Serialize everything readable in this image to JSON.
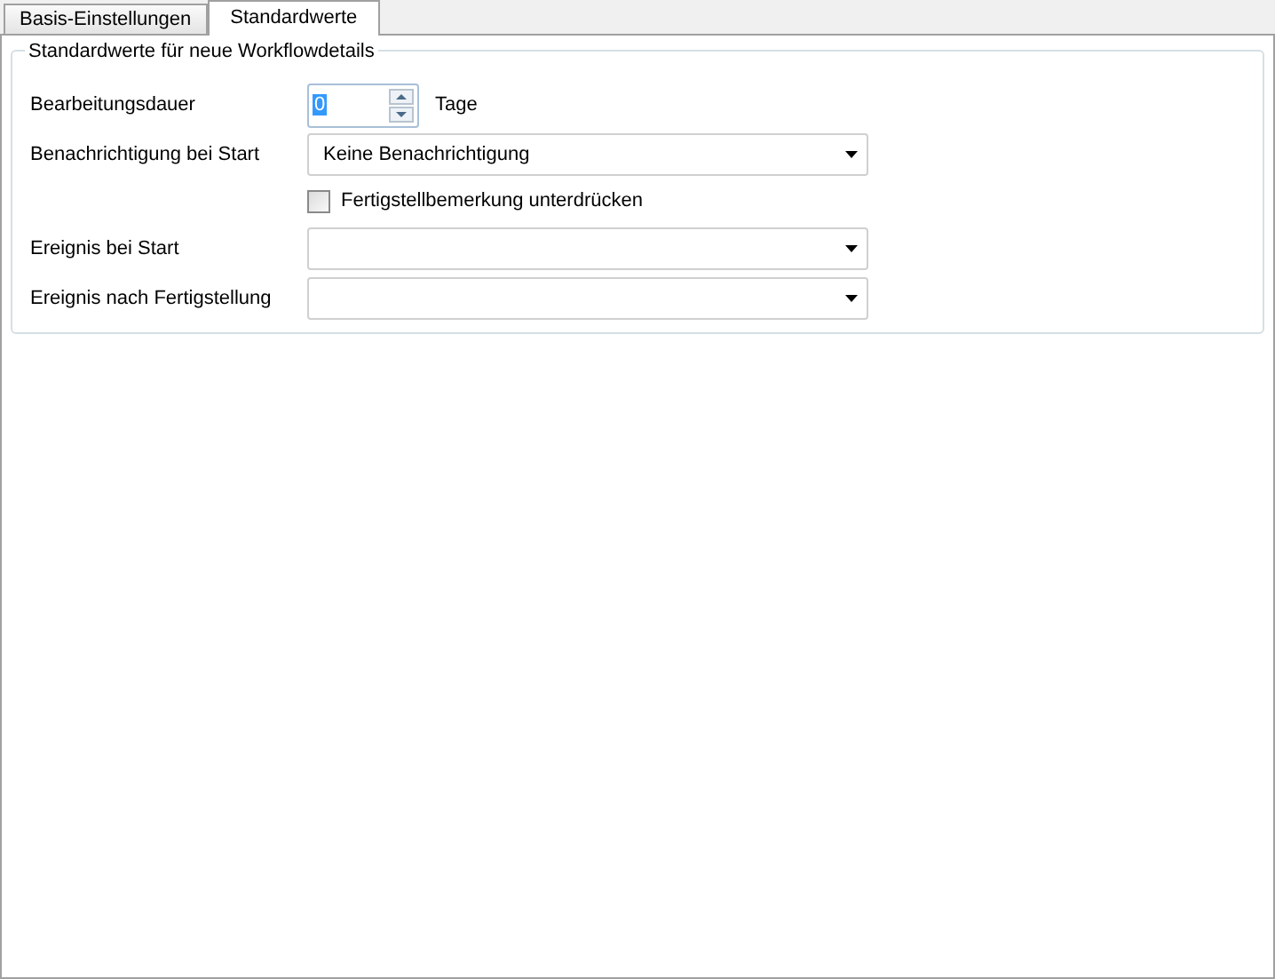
{
  "tabs": [
    {
      "label": "Basis-Einstellungen",
      "selected": false
    },
    {
      "label": "Standardwerte",
      "selected": true
    }
  ],
  "group": {
    "title": "Standardwerte für neue Workflowdetails",
    "rows": [
      {
        "kind": "spinner",
        "label": "Bearbeitungsdauer",
        "value": "0",
        "unit": "Tage"
      },
      {
        "kind": "combo",
        "label": "Benachrichtigung bei Start",
        "value": "Keine Benachrichtigung"
      },
      {
        "kind": "checkbox",
        "text": "Fertigstellbemerkung unterdrücken",
        "checked": false
      },
      {
        "kind": "combo",
        "label": "Ereignis bei Start"
      },
      {
        "kind": "combo",
        "label": "Ereignis nach Fertigstellung"
      }
    ]
  }
}
